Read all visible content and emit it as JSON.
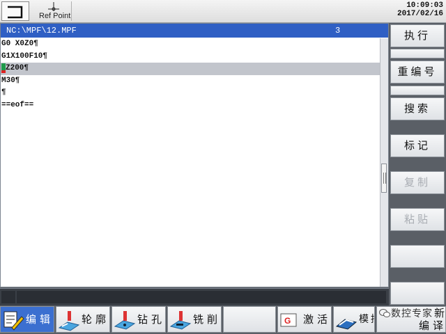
{
  "topbar": {
    "ref_point_label": "Ref Point",
    "time": "10:09:03",
    "date": "2017/02/16"
  },
  "editor": {
    "file_path": "NC:\\MPF\\12.MPF",
    "channel": "3",
    "lines": [
      {
        "text": "G0 X0Z0¶",
        "active": false
      },
      {
        "text": "G1X100F10¶",
        "active": false
      },
      {
        "text": "Z200¶",
        "active": true
      },
      {
        "text": "M30¶",
        "active": false
      },
      {
        "text": "¶",
        "active": false
      },
      {
        "text": "==eof==",
        "active": false
      }
    ]
  },
  "vertical_softkeys": [
    {
      "label": "执行",
      "enabled": true
    },
    {
      "label": "",
      "enabled": true
    },
    {
      "label": "重编号",
      "enabled": true
    },
    {
      "label": "",
      "enabled": true
    },
    {
      "label": "搜索",
      "enabled": true
    },
    {
      "label": "标记",
      "enabled": true
    },
    {
      "label": "复制",
      "enabled": false
    },
    {
      "label": "粘贴",
      "enabled": false
    },
    {
      "label": "",
      "enabled": true
    },
    {
      "label": "",
      "enabled": true
    }
  ],
  "horizontal_softkeys": [
    {
      "label": "编辑",
      "icon": "edit-icon",
      "active": true
    },
    {
      "label": "轮廓",
      "icon": "contour-icon",
      "active": false
    },
    {
      "label": "钻孔",
      "icon": "drilling-icon",
      "active": false
    },
    {
      "label": "铣削",
      "icon": "milling-icon",
      "active": false
    },
    {
      "label": "",
      "icon": "",
      "active": false
    },
    {
      "label": "激活",
      "icon": "g-code-icon",
      "active": false
    },
    {
      "label": "模拟",
      "icon": "simulation-icon",
      "active": false
    }
  ],
  "watermark": "数控专家",
  "new_key": {
    "line1": "新",
    "line2": "编译"
  },
  "colors": {
    "header_blue": "#2f5fc4",
    "active_key": "#3b6fd0",
    "highlight_line": "#c2c5cc"
  }
}
